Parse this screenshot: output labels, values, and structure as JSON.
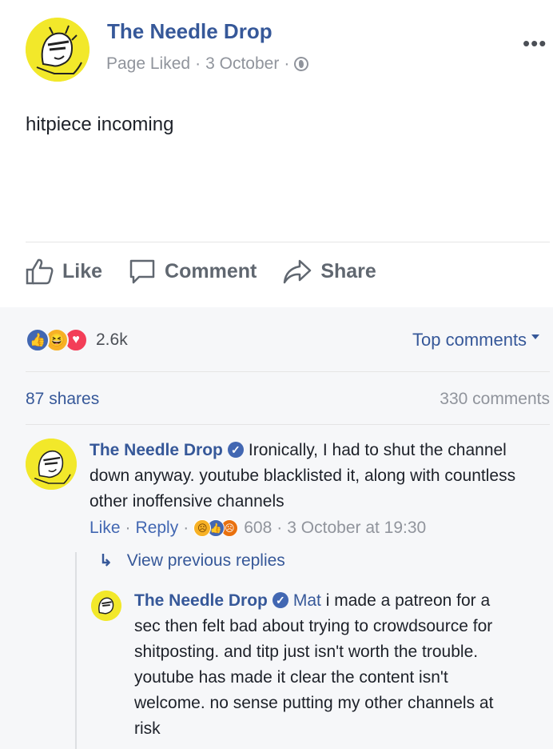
{
  "post": {
    "page_name": "The Needle Drop",
    "status": "Page Liked",
    "date": "3 October",
    "text": "hitpiece incoming",
    "more_label": "•••",
    "actions": {
      "like": "Like",
      "comment": "Comment",
      "share": "Share"
    },
    "reaction_icons": [
      "like",
      "haha",
      "love"
    ],
    "reaction_count": "2.6k",
    "sort_label": "Top comments",
    "shares": "87 shares",
    "comments_count": "330 comments"
  },
  "comment": {
    "author": "The Needle Drop",
    "text": "Ironically, I had to shut the channel down anyway. youtube blacklisted it, along with countless other inoffensive channels",
    "like_label": "Like",
    "reply_label": "Reply",
    "reaction_icons": [
      "sad",
      "like",
      "angry"
    ],
    "reaction_count": "608",
    "timestamp": "3 October at 19:30"
  },
  "view_previous_replies": "View previous replies",
  "reply": {
    "author": "The Needle Drop",
    "mention": "Mat",
    "text": "i made a patreon for a sec then felt bad about trying to crowdsource for shitposting. and titp just isn't worth the trouble. youtube has made it clear the content isn't welcome. no sense putting my other channels at risk"
  },
  "colors": {
    "link": "#365899",
    "brand": "#4267b2",
    "avatar_bg": "#f2e82a",
    "muted": "#90949c"
  }
}
